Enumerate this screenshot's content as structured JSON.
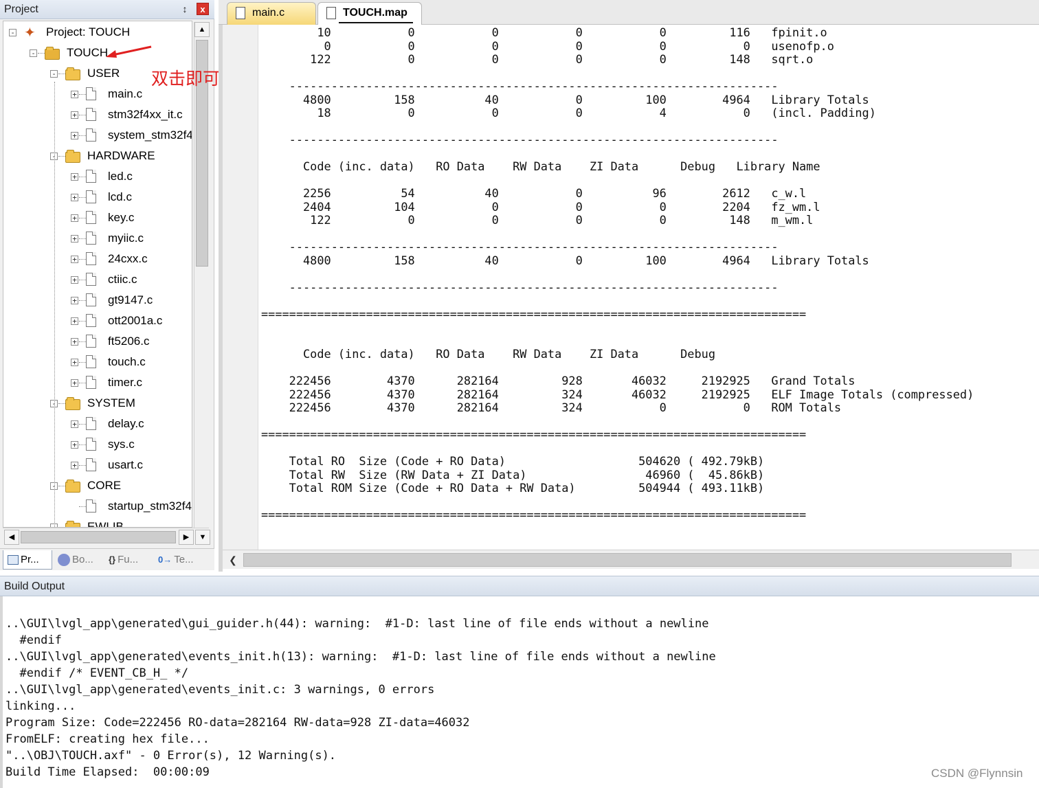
{
  "project_panel": {
    "title": "Project",
    "pin_icon": "pin-icon",
    "close_label": "x",
    "tree": [
      {
        "label": "Project: TOUCH",
        "type": "project",
        "level": 0,
        "expander": "-"
      },
      {
        "label": "TOUCH",
        "type": "target",
        "level": 1,
        "expander": "-"
      },
      {
        "label": "USER",
        "type": "folder",
        "level": 2,
        "expander": "-"
      },
      {
        "label": "main.c",
        "type": "file",
        "level": 3,
        "expander": "+"
      },
      {
        "label": "stm32f4xx_it.c",
        "type": "file",
        "level": 3,
        "expander": "+"
      },
      {
        "label": "system_stm32f4",
        "type": "file",
        "level": 3,
        "expander": "+"
      },
      {
        "label": "HARDWARE",
        "type": "folder",
        "level": 2,
        "expander": "-"
      },
      {
        "label": "led.c",
        "type": "file",
        "level": 3,
        "expander": "+"
      },
      {
        "label": "lcd.c",
        "type": "file",
        "level": 3,
        "expander": "+"
      },
      {
        "label": "key.c",
        "type": "file",
        "level": 3,
        "expander": "+"
      },
      {
        "label": "myiic.c",
        "type": "file",
        "level": 3,
        "expander": "+"
      },
      {
        "label": "24cxx.c",
        "type": "file",
        "level": 3,
        "expander": "+"
      },
      {
        "label": "ctiic.c",
        "type": "file",
        "level": 3,
        "expander": "+"
      },
      {
        "label": "gt9147.c",
        "type": "file",
        "level": 3,
        "expander": "+"
      },
      {
        "label": "ott2001a.c",
        "type": "file",
        "level": 3,
        "expander": "+"
      },
      {
        "label": "ft5206.c",
        "type": "file",
        "level": 3,
        "expander": "+"
      },
      {
        "label": "touch.c",
        "type": "file",
        "level": 3,
        "expander": "+"
      },
      {
        "label": "timer.c",
        "type": "file",
        "level": 3,
        "expander": "+"
      },
      {
        "label": "SYSTEM",
        "type": "folder",
        "level": 2,
        "expander": "-"
      },
      {
        "label": "delay.c",
        "type": "file",
        "level": 3,
        "expander": "+"
      },
      {
        "label": "sys.c",
        "type": "file",
        "level": 3,
        "expander": "+"
      },
      {
        "label": "usart.c",
        "type": "file",
        "level": 3,
        "expander": "+"
      },
      {
        "label": "CORE",
        "type": "folder",
        "level": 2,
        "expander": "-"
      },
      {
        "label": "startup_stm32f4",
        "type": "file",
        "level": 3,
        "expander": ""
      },
      {
        "label": "EWLIB",
        "type": "folder",
        "level": 2,
        "expander": "-"
      }
    ],
    "tabs": [
      {
        "label": "Pr...",
        "icon": "project-icon",
        "active": true
      },
      {
        "label": "Bo...",
        "icon": "books-icon",
        "active": false
      },
      {
        "label": "Fu...",
        "icon": "functions-icon",
        "glyph": "{}",
        "active": false
      },
      {
        "label": "Te...",
        "icon": "templates-icon",
        "glyph": "0→",
        "active": false
      }
    ]
  },
  "annotation": {
    "text": "双击即可产生.map文件",
    "color": "#e02020"
  },
  "editor": {
    "tabs": [
      {
        "label": "main.c",
        "active": false
      },
      {
        "label": "TOUCH.map",
        "active": true
      }
    ],
    "lines": [
      "        10           0           0           0           0         116   fpinit.o",
      "         0           0           0           0           0           0   usenofp.o",
      "       122           0           0           0           0         148   sqrt.o",
      "",
      "    ----------------------------------------------------------------------",
      "      4800         158          40           0         100        4964   Library Totals",
      "        18           0           0           0           4           0   (incl. Padding)",
      "",
      "    ----------------------------------------------------------------------",
      "",
      "      Code (inc. data)   RO Data    RW Data    ZI Data      Debug   Library Name",
      "",
      "      2256          54          40           0          96        2612   c_w.l",
      "      2404         104           0           0           0        2204   fz_wm.l",
      "       122           0           0           0           0         148   m_wm.l",
      "",
      "    ----------------------------------------------------------------------",
      "      4800         158          40           0         100        4964   Library Totals",
      "",
      "    ----------------------------------------------------------------------",
      "",
      "==============================================================================",
      "",
      "",
      "      Code (inc. data)   RO Data    RW Data    ZI Data      Debug",
      "",
      "    222456        4370      282164         928       46032     2192925   Grand Totals",
      "    222456        4370      282164         324       46032     2192925   ELF Image Totals (compressed)",
      "    222456        4370      282164         324           0           0   ROM Totals",
      "",
      "==============================================================================",
      "",
      "    Total RO  Size (Code + RO Data)                   504620 ( 492.79kB)",
      "    Total RW  Size (RW Data + ZI Data)                 46960 (  45.86kB)",
      "    Total ROM Size (Code + RO Data + RW Data)         504944 ( 493.11kB)",
      "",
      "=============================================================================="
    ]
  },
  "build_output": {
    "title": "Build Output",
    "lines": [
      "..\\GUI\\lvgl_app\\generated\\gui_guider.h(44): warning:  #1-D: last line of file ends without a newline",
      "  #endif",
      "..\\GUI\\lvgl_app\\generated\\events_init.h(13): warning:  #1-D: last line of file ends without a newline",
      "  #endif /* EVENT_CB_H_ */",
      "..\\GUI\\lvgl_app\\generated\\events_init.c: 3 warnings, 0 errors",
      "linking...",
      "Program Size: Code=222456 RO-data=282164 RW-data=928 ZI-data=46032",
      "FromELF: creating hex file...",
      "\"..\\OBJ\\TOUCH.axf\" - 0 Error(s), 12 Warning(s).",
      "Build Time Elapsed:  00:00:09"
    ]
  },
  "watermark": "CSDN @Flynnsin"
}
